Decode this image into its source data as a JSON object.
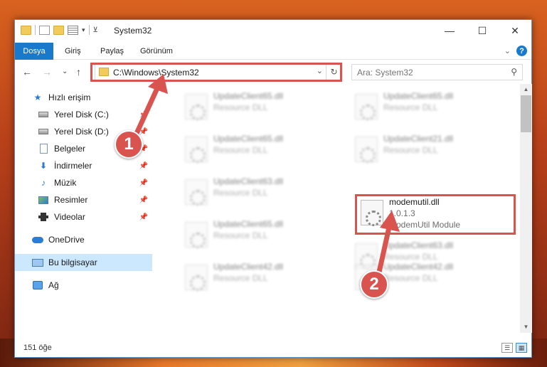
{
  "window": {
    "title": "System32",
    "controls": {
      "minimize": "—",
      "maximize": "☐",
      "close": "✕"
    }
  },
  "ribbon": {
    "tabs": [
      "Dosya",
      "Giriş",
      "Paylaş",
      "Görünüm"
    ],
    "expand": "⌄",
    "help": "?"
  },
  "address": {
    "path": "C:\\Windows\\System32",
    "dropdown": "⌄",
    "refresh": "↻"
  },
  "search": {
    "placeholder": "Ara: System32",
    "icon": "search-icon"
  },
  "nav": {
    "back": "←",
    "forward": "→",
    "recent": "⌄",
    "up": "↑"
  },
  "sidebar": {
    "items": [
      {
        "label": "Hızlı erişim",
        "icon": "star-icon"
      },
      {
        "label": "Yerel Disk (C:)",
        "icon": "disk-icon",
        "pinned": true
      },
      {
        "label": "Yerel Disk (D:)",
        "icon": "disk-icon",
        "pinned": true
      },
      {
        "label": "Belgeler",
        "icon": "documents-icon",
        "pinned": true
      },
      {
        "label": "İndirmeler",
        "icon": "downloads-icon",
        "pinned": true
      },
      {
        "label": "Müzik",
        "icon": "music-icon",
        "pinned": true
      },
      {
        "label": "Resimler",
        "icon": "pictures-icon",
        "pinned": true
      },
      {
        "label": "Videolar",
        "icon": "videos-icon",
        "pinned": true
      },
      {
        "label": "OneDrive",
        "icon": "onedrive-icon"
      },
      {
        "label": "Bu bilgisayar",
        "icon": "this-pc-icon",
        "selected": true
      },
      {
        "label": "Ağ",
        "icon": "network-icon"
      }
    ]
  },
  "files": [
    {
      "name": "UpdateClient65.dll",
      "desc": "Resource DLL"
    },
    {
      "name": "UpdateClient65.dll",
      "desc": "Resource DLL"
    },
    {
      "name": "UpdateClient65.dll",
      "desc": "Resource DLL"
    },
    {
      "name": "UpdateClient21.dll",
      "desc": "Resource DLL"
    },
    {
      "name": "UpdateClient63.dll",
      "desc": "Resource DLL"
    },
    {
      "name": "modemutil.dll",
      "version": "1.0.1.3",
      "desc": "ModemUtil Module"
    },
    {
      "name": "UpdateClient65.dll",
      "desc": "Resource DLL"
    },
    {
      "name": "UpdateClient63.dll",
      "desc": "Resource DLL"
    },
    {
      "name": "UpdateClient42.dll",
      "desc": "Resource DLL"
    },
    {
      "name": "UpdateClient42.dll",
      "desc": "Resource DLL"
    }
  ],
  "status": {
    "count": "151 öğe"
  },
  "callouts": {
    "step1": "1",
    "step2": "2"
  },
  "colors": {
    "accent": "#1979ca",
    "highlight": "#d9534f",
    "selected": "#cce8ff"
  }
}
